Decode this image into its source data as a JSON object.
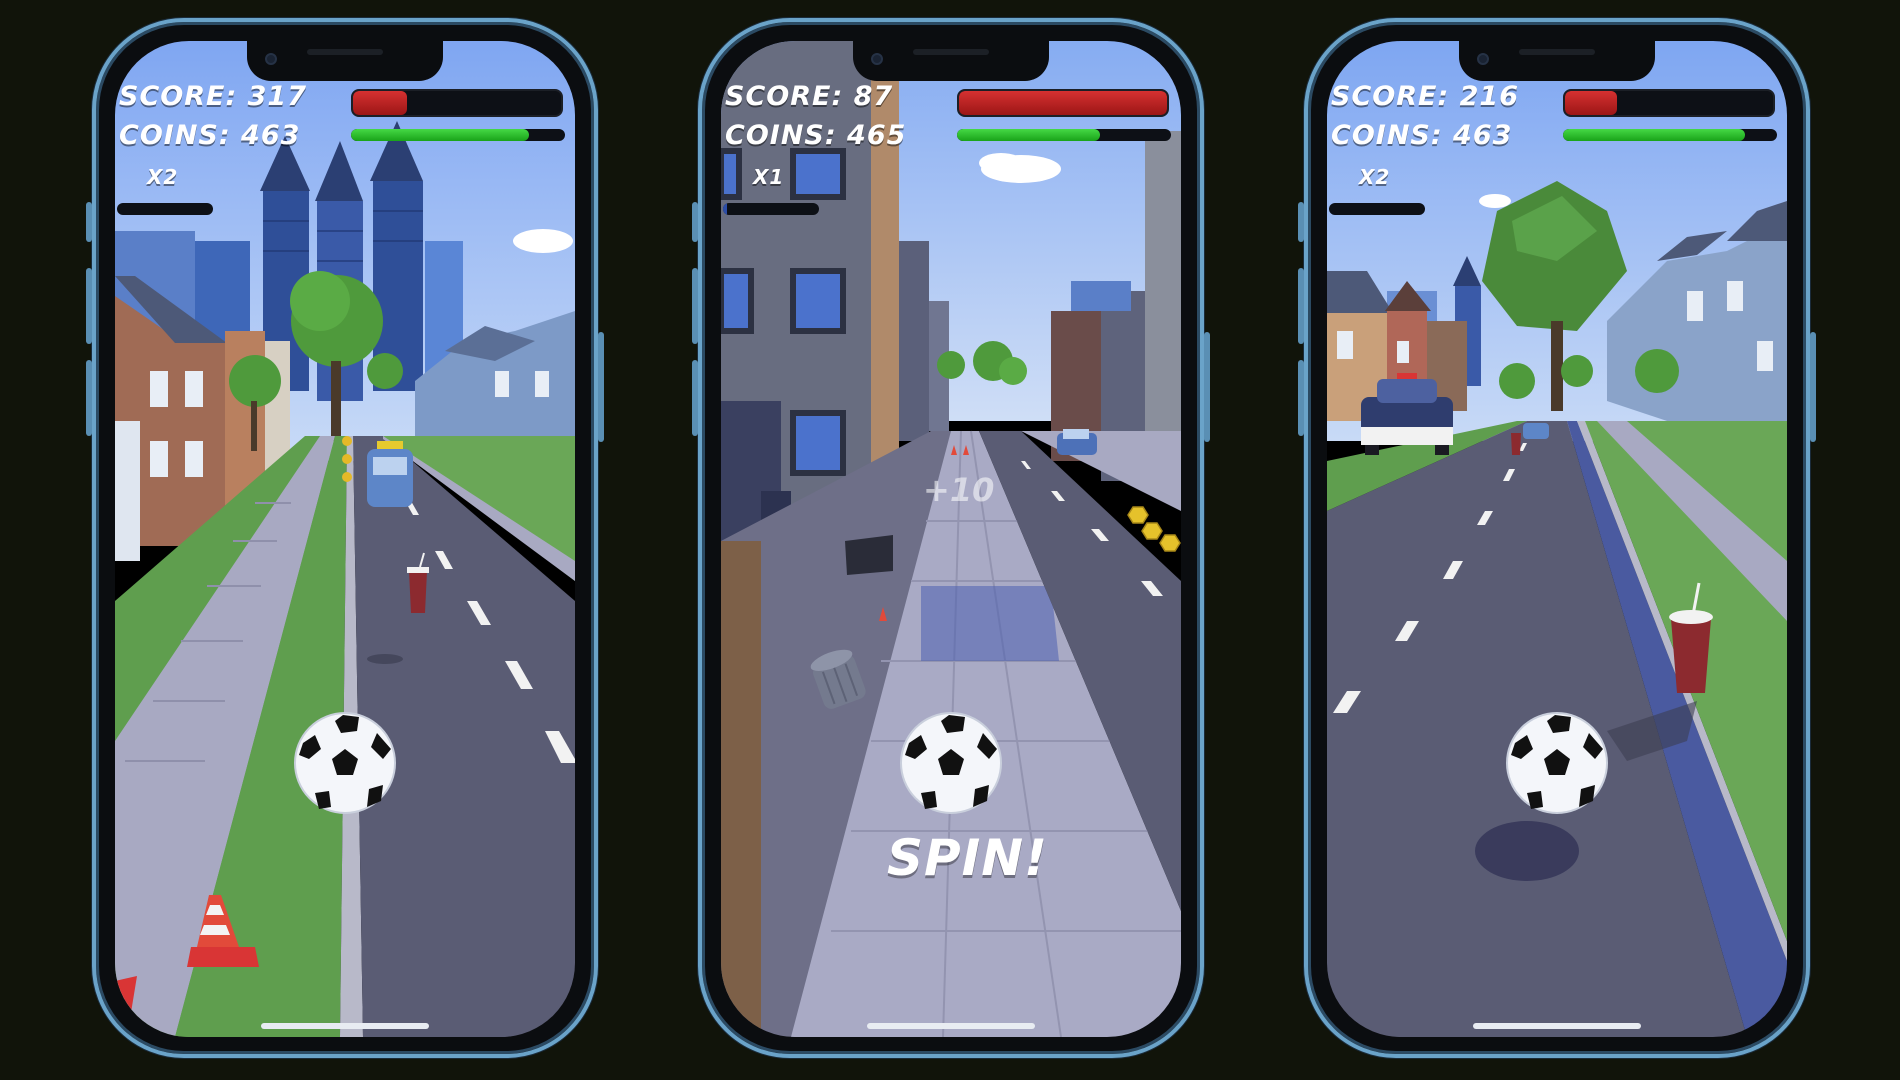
{
  "theme": {
    "background": "#11140a",
    "phone_frame": "#6aa3c9",
    "health_color": "#d63131",
    "stamina_color": "#2ed22e",
    "multiplier_color": "#2d4ea8"
  },
  "phones": [
    {
      "scene": "suburban road with downtown skyline",
      "hud": {
        "score": "SCORE: 317",
        "coins": "COINS: 463",
        "multiplier": "X2"
      },
      "health_fraction": 0.26,
      "stamina_fraction": 0.83,
      "multiplier_progress": 0.0,
      "icons": [
        "soccer-ball-icon",
        "traffic-cone-icon",
        "soda-cup-icon"
      ]
    },
    {
      "scene": "city sidewalk between apartment buildings",
      "hud": {
        "score": "SCORE: 87",
        "coins": "COINS: 465",
        "multiplier": "X1"
      },
      "health_fraction": 1.0,
      "stamina_fraction": 0.67,
      "multiplier_progress": 0.04,
      "popups": {
        "plus": "+10",
        "spin": "SPIN!"
      },
      "icons": [
        "soccer-ball-icon",
        "trash-can-icon",
        "coin-icon"
      ]
    },
    {
      "scene": "residential street with police car",
      "hud": {
        "score": "SCORE: 216",
        "coins": "COINS: 463",
        "multiplier": "X2"
      },
      "health_fraction": 0.25,
      "stamina_fraction": 0.85,
      "multiplier_progress": 0.0,
      "icons": [
        "soccer-ball-icon",
        "police-car-icon",
        "soda-cup-icon"
      ]
    }
  ]
}
